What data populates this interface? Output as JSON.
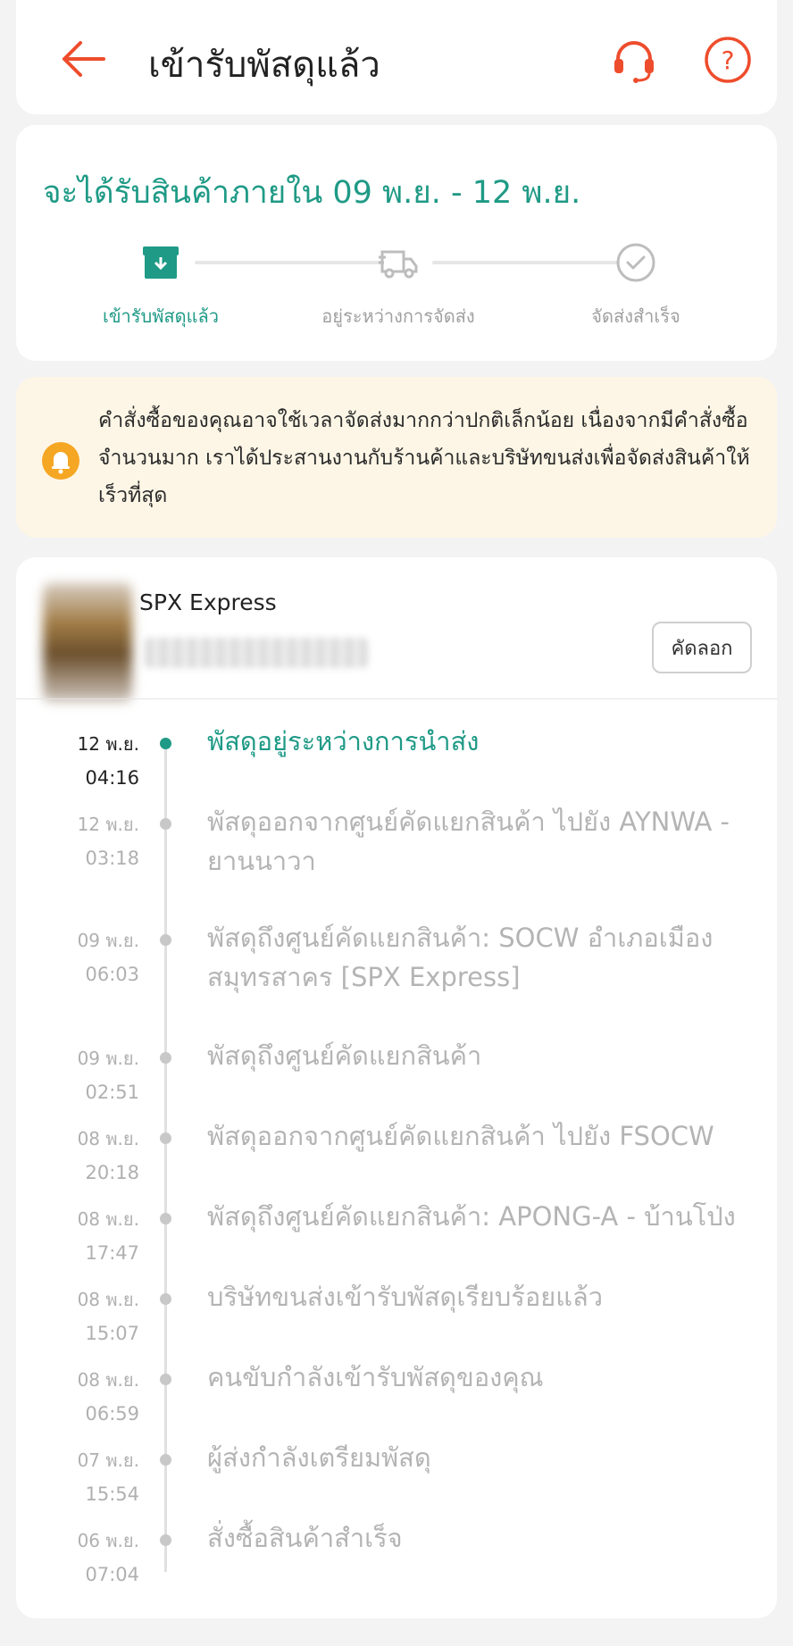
{
  "header": {
    "title": "เข้ารับพัสดุแล้ว"
  },
  "status": {
    "eta": "จะได้รับสินค้าภายใน 09 พ.ย. - 12 พ.ย.",
    "steps": [
      {
        "label": "เข้ารับพัสดุแล้ว",
        "icon": "package-icon"
      },
      {
        "label": "อยู่ระหว่างการจัดส่ง",
        "icon": "truck-icon"
      },
      {
        "label": "จัดส่งสำเร็จ",
        "icon": "check-circle-icon"
      }
    ]
  },
  "notice": {
    "text": "คำสั่งซื้อของคุณอาจใช้เวลาจัดส่งมากกว่าปกติเล็กน้อย เนื่องจากมีคำสั่งซื้อจำนวนมาก เราได้ประสานงานกับร้านค้าและบริษัทขนส่งเพื่อจัดส่งสินค้าให้เร็วที่สุด"
  },
  "tracking": {
    "courier": "SPX Express",
    "copy_label": "คัดลอก",
    "events": [
      {
        "date": "12 พ.ย.",
        "time": "04:16",
        "desc": "พัสดุอยู่ระหว่างการนำส่ง"
      },
      {
        "date": "12 พ.ย.",
        "time": "03:18",
        "desc": "พัสดุออกจากศูนย์คัดแยกสินค้า ไปยัง AYNWA - ยานนาวา"
      },
      {
        "date": "09 พ.ย.",
        "time": "06:03",
        "desc": "พัสดุถึงศูนย์คัดแยกสินค้า: SOCW อำเภอเมืองสมุทรสาคร [SPX Express]"
      },
      {
        "date": "09 พ.ย.",
        "time": "02:51",
        "desc": "พัสดุถึงศูนย์คัดแยกสินค้า"
      },
      {
        "date": "08 พ.ย.",
        "time": "20:18",
        "desc": "พัสดุออกจากศูนย์คัดแยกสินค้า ไปยัง FSOCW"
      },
      {
        "date": "08 พ.ย.",
        "time": "17:47",
        "desc": "พัสดุถึงศูนย์คัดแยกสินค้า: APONG-A - บ้านโป่ง"
      },
      {
        "date": "08 พ.ย.",
        "time": "15:07",
        "desc": "บริษัทขนส่งเข้ารับพัสดุเรียบร้อยแล้ว"
      },
      {
        "date": "08 พ.ย.",
        "time": "06:59",
        "desc": "คนขับกำลังเข้ารับพัสดุของคุณ"
      },
      {
        "date": "07 พ.ย.",
        "time": "15:54",
        "desc": " ผู้ส่งกำลังเตรียมพัสดุ"
      },
      {
        "date": "06 พ.ย.",
        "time": "07:04",
        "desc": "สั่งซื้อสินค้าสำเร็จ"
      }
    ]
  },
  "colors": {
    "accent": "#1f9a86",
    "brand": "#ee4d2d",
    "notice_bg": "#fdf6e6",
    "bell": "#f5a623"
  }
}
